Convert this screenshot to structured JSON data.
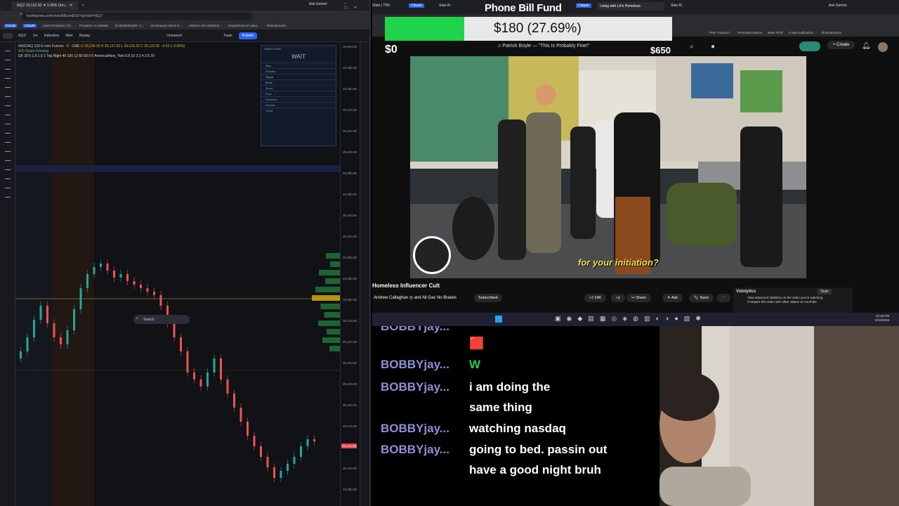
{
  "browser_left": {
    "tab_title": "NQ1! 29,132.50 ▼ 0.49% Unn...",
    "url": "tradingview.com/chart/bBcvmlDU/?symbol=NQ1!",
    "bookmarks": [
      "Claude",
      "Claude",
      "Latest Products | Kli...",
      "Products / In Debate",
      "(2) BetterReddit • 1...",
      "19 Reasons We're C...",
      "UNION LOS ANGELE...",
      "Department of Labor...",
      "All Bookmarks"
    ],
    "ask_label": "Ask Gemini"
  },
  "tradingview": {
    "symbol": "NQ1!",
    "interval": "1m",
    "toolbar": [
      "Indicators",
      "Alert",
      "Replay"
    ],
    "layout_name": "Unnamed",
    "trade_label": "Trade",
    "publish_label": "Publish",
    "legend_line1": "NASDAQ 100 E-mini Futures · 5 · CME",
    "legend_ohlc": "O 29,134.25  H 29,137.00  L 29,126.25  C 29,132.50  −0.50 (−0.00%)",
    "legend_line2": "AIO Quant Intraday",
    "legend_line3": "GF 20 5 1.5 1.5 1 Top Right 40 100 12 65 60 0 0 America/New_York 0.8 10 3 2 4 2.5 20",
    "price_labels": [
      "29,500.00",
      "29,480.00",
      "29,460.00",
      "29,440.00",
      "29,420.00",
      "29,400.00",
      "29,380.00",
      "29,360.00",
      "29,340.00",
      "29,320.00",
      "29,300.00",
      "29,280.00",
      "29,260.00",
      "29,240.00",
      "29,220.00",
      "29,200.00",
      "29,180.00",
      "29,160.00",
      "29,140.00",
      "29,120.00",
      "29,100.00",
      "29,080.00"
    ],
    "current_price": "29,132.50",
    "cashflow": {
      "title": "CASH FLOW",
      "status": "WAIT",
      "rows": [
        "Bias",
        "Session",
        "Signal",
        "Mode",
        "Score",
        "Flow",
        "Structure",
        "Volume",
        "Trend"
      ]
    }
  },
  "browser_right": {
    "tabs": [
      "Slate | TBS",
      "Claude",
      "Stan AI",
      "Claude",
      "Living with LA's Homeless",
      "Stan AI"
    ],
    "ask_label": "Ask Gemini",
    "bookmarks": [
      "Post \"Finance\" -",
      "Personal Finance",
      "Been #Trill",
      "2 new notification...",
      "All Bookmarks"
    ]
  },
  "fund": {
    "title": "Phone Bill Fund",
    "amount": "$180 (27.69%)",
    "progress": 0.2769,
    "min": "$0",
    "max": "$650"
  },
  "youtube": {
    "now_playing": "Patrick Boyle — \"This Is Probably Fine!\"",
    "create_label": "Create",
    "caption": "for your initiation?",
    "title": "Homeless Influencer Cult",
    "channel": "Andrew Callaghan ◎ and All Gas No Brakes",
    "subscribed": "Subscribed",
    "likes": "16K",
    "share": "Share",
    "ask": "Ask",
    "save": "Save",
    "vidolytics_title": "Vidolytics",
    "vidolytics_tools": "Tools",
    "vidolytics_line1": "View advanced statistics on the video you're watching",
    "vidolytics_line2": "Compare this video with other videos on YouTube"
  },
  "taskbar": {
    "search_placeholder": "Search",
    "time": "10:18 PM",
    "date": "8/23/2026"
  },
  "chat": {
    "messages": [
      {
        "user": "BOBBYjay...",
        "text": ""
      },
      {
        "user": "",
        "text": "🟥"
      },
      {
        "user": "BOBBYjay...",
        "text": "W"
      },
      {
        "user": "BOBBYjay...",
        "text": "i am doing the same thing"
      },
      {
        "user": "BOBBYjay...",
        "text": "watching nasdaq"
      },
      {
        "user": "BOBBYjay...",
        "text": "going to bed. passin out have a good night bruh"
      }
    ]
  }
}
